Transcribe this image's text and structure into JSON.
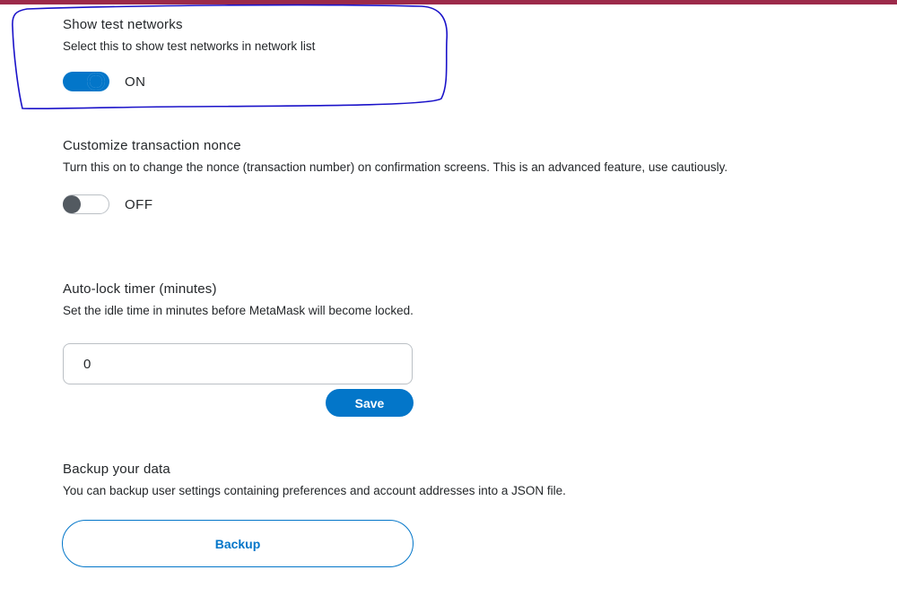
{
  "colors": {
    "accent": "#0376c9",
    "top_bar": "#9c2a4a",
    "annotation": "#1a12c9",
    "text": "#24272a"
  },
  "test_networks": {
    "title": "Show test networks",
    "description": "Select this to show test networks in network list",
    "toggle_state": "on",
    "toggle_label": "ON"
  },
  "nonce": {
    "title": "Customize transaction nonce",
    "description": "Turn this on to change the nonce (transaction number) on confirmation screens. This is an advanced feature, use cautiously.",
    "toggle_state": "off",
    "toggle_label": "OFF"
  },
  "autolock": {
    "title": "Auto-lock timer (minutes)",
    "description": "Set the idle time in minutes before MetaMask will become locked.",
    "value": "0",
    "save_label": "Save"
  },
  "backup": {
    "title": "Backup your data",
    "description": "You can backup user settings containing preferences and account addresses into a JSON file.",
    "button_label": "Backup"
  }
}
